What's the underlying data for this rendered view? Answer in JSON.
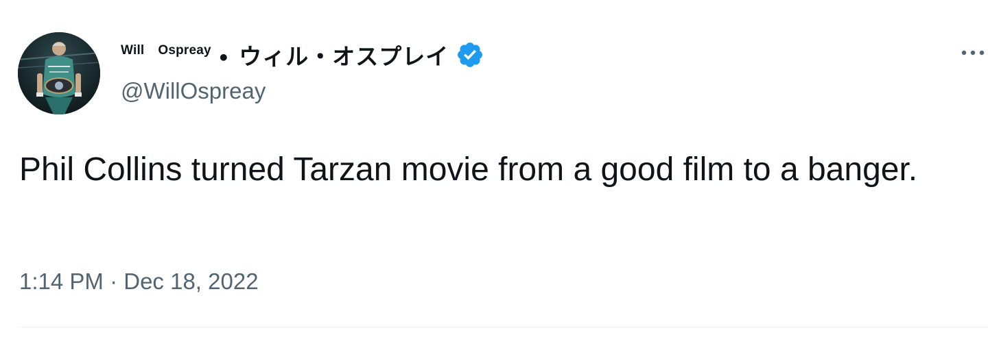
{
  "author": {
    "display_name_latin_first": "Will",
    "display_name_latin_second": "Ospreay",
    "display_name_separator": "•",
    "display_name_japanese": "ウィル・オスプレイ",
    "handle": "@WillOspreay",
    "verified": true
  },
  "tweet": {
    "text": "Phil Collins turned Tarzan movie from a good film to a banger.",
    "time": "1:14 PM",
    "separator": "·",
    "date": "Dec 18, 2022"
  },
  "icons": {
    "verified": "verified-badge-icon",
    "more": "more-options-icon"
  },
  "colors": {
    "text_primary": "#0f1419",
    "text_secondary": "#536471",
    "verified_blue": "#1d9bf0",
    "divider": "#eff3f4"
  }
}
